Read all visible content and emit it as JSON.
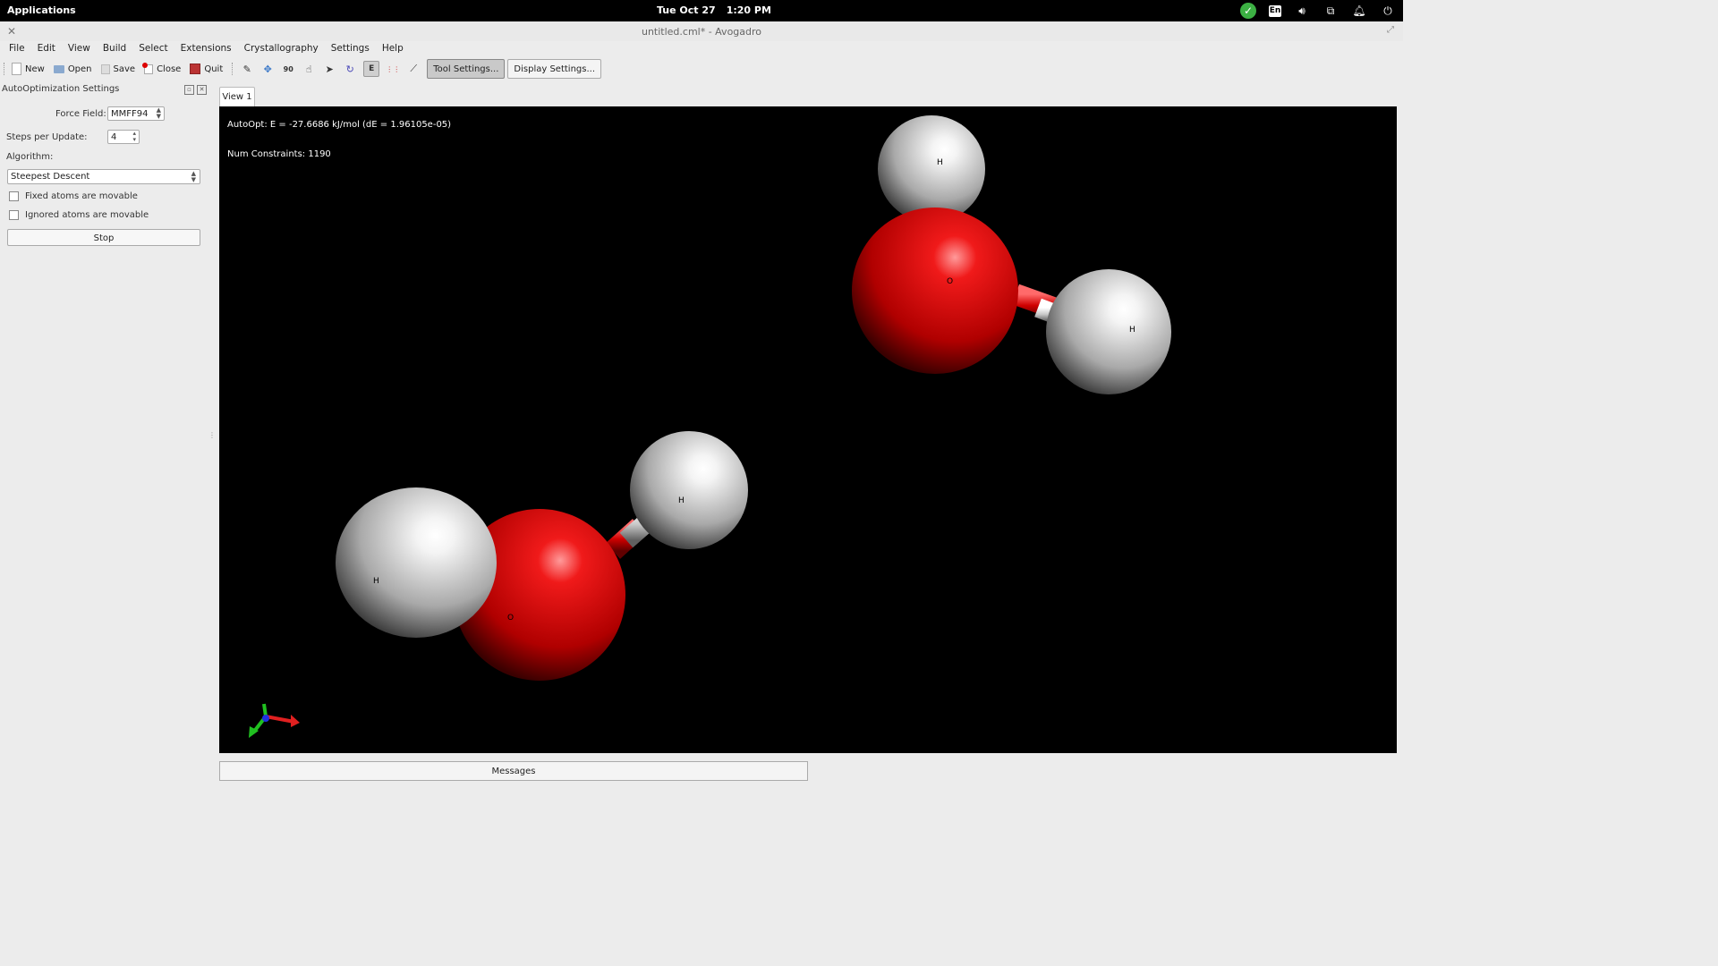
{
  "top_panel": {
    "applications_label": "Applications",
    "date": "Tue Oct 27",
    "time": "1:20 PM",
    "tray": [
      "check-icon",
      "en",
      "volume-icon",
      "network-icon",
      "bell-icon",
      "power-icon"
    ],
    "keyboard_layout": "En"
  },
  "window": {
    "title": "untitled.cml* - Avogadro"
  },
  "menu": [
    "File",
    "Edit",
    "View",
    "Build",
    "Select",
    "Extensions",
    "Crystallography",
    "Settings",
    "Help"
  ],
  "toolbar": {
    "new_label": "New",
    "open_label": "Open",
    "save_label": "Save",
    "close_label": "Close",
    "quit_label": "Quit",
    "tools": [
      "draw-icon",
      "navigate-icon",
      "measure-icon",
      "manipulate-icon",
      "select-icon",
      "rotate-icon",
      "autoopt-icon",
      "align-icon",
      "bond-centric-icon"
    ],
    "tool_settings_label": "Tool Settings...",
    "display_settings_label": "Display Settings..."
  },
  "autoopt_panel": {
    "title": "AutoOptimization Settings",
    "force_field_label": "Force Field:",
    "force_field_value": "MMFF94",
    "steps_label": "Steps per Update:",
    "steps_value": "4",
    "algorithm_label": "Algorithm:",
    "algorithm_value": "Steepest Descent",
    "fixed_atoms_label": "Fixed atoms are movable",
    "fixed_atoms_checked": false,
    "ignored_atoms_label": "Ignored atoms are movable",
    "ignored_atoms_checked": false,
    "stop_label": "Stop"
  },
  "view": {
    "tab_label": "View 1",
    "energy_text": "AutoOpt: E = -27.6686 kJ/mol (dE = 1.96105e-05)",
    "constraints_text": "Num Constraints: 1190",
    "atom_labels": [
      "H",
      "O",
      "H",
      "H",
      "H",
      "O"
    ],
    "background_color": "#000000",
    "oxygen_color": "#e00000",
    "hydrogen_color": "#d8d8d8"
  },
  "messages_label": "Messages"
}
